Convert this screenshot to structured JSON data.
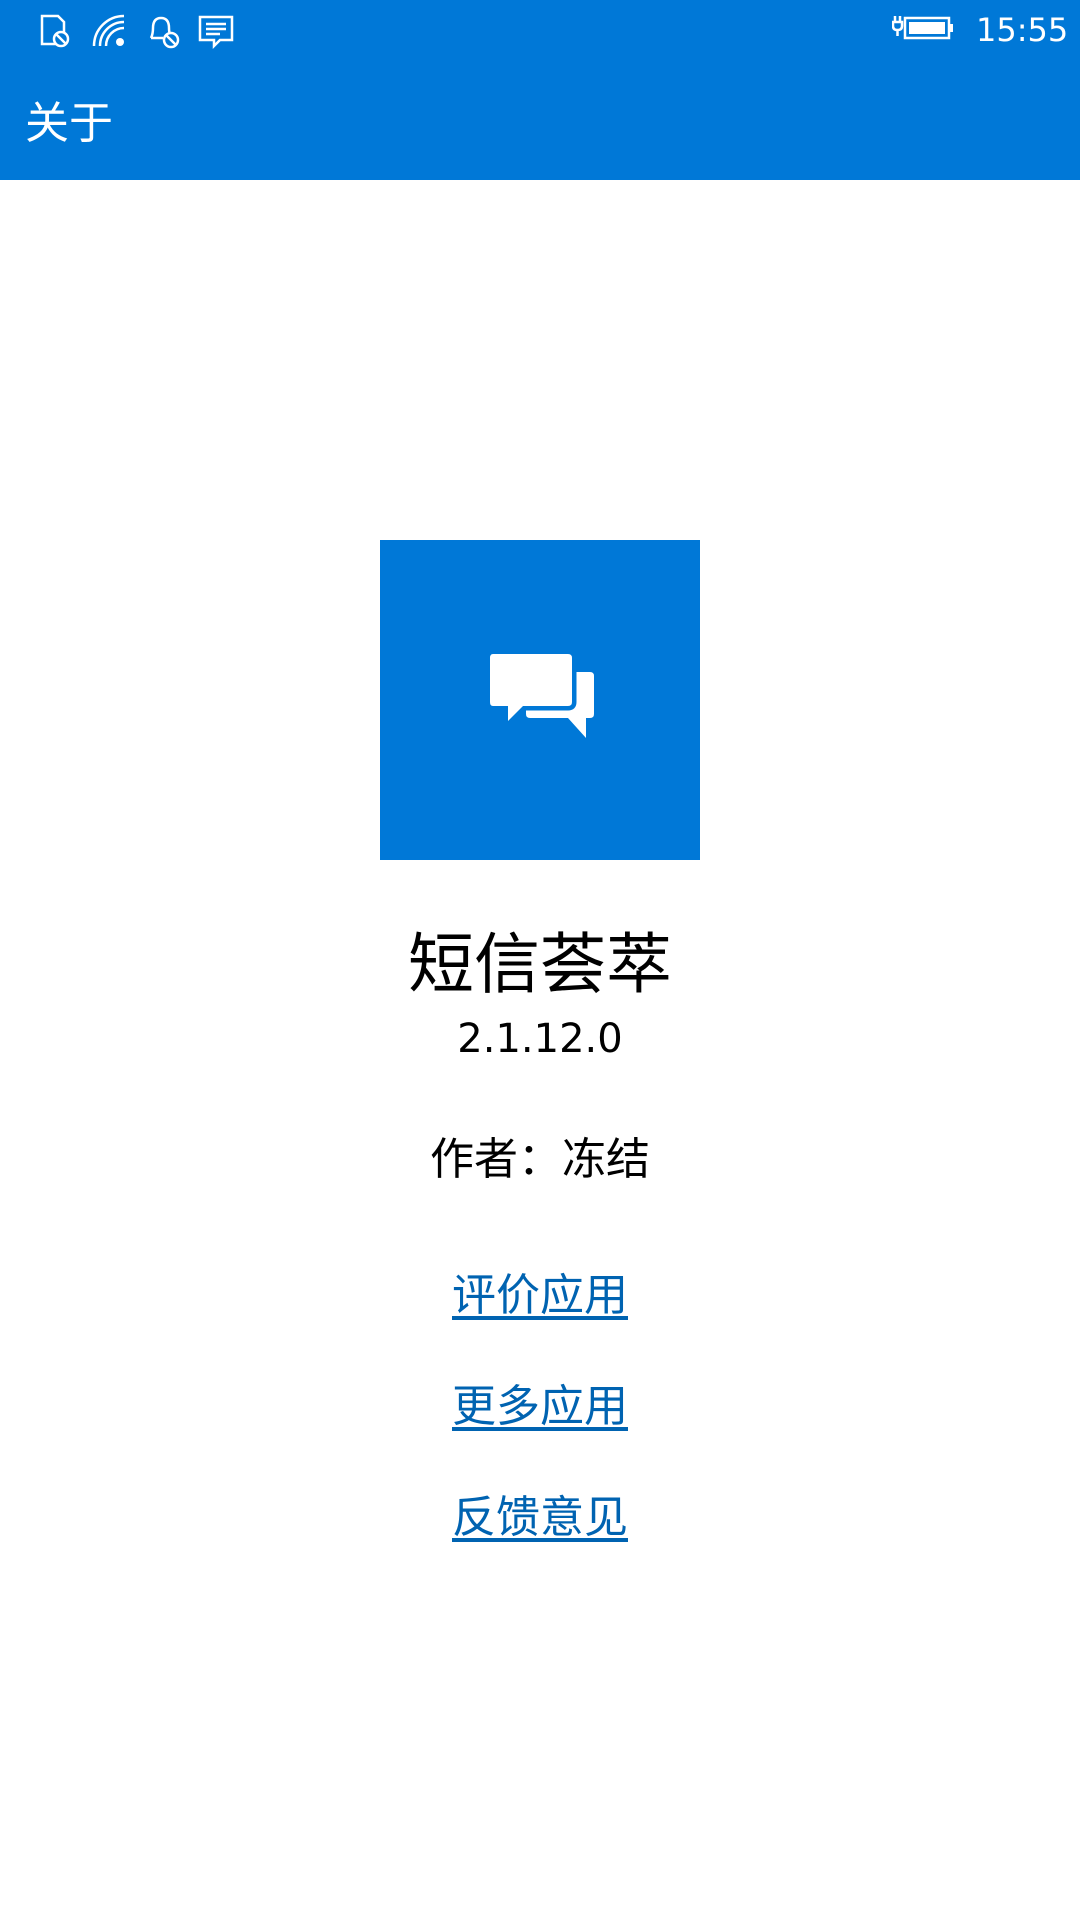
{
  "status_bar": {
    "icons": [
      "no-sim-icon",
      "wifi-icon",
      "quiet-hours-icon",
      "message-icon",
      "battery-charging-icon"
    ],
    "time": "15:55"
  },
  "header": {
    "title": "关于",
    "background_color": "#0078d7"
  },
  "app": {
    "logo_icon": "chat-bubbles-icon",
    "name": "短信荟萃",
    "version": "2.1.12.0",
    "author": "作者：冻结"
  },
  "links": {
    "rate": "评价应用",
    "more": "更多应用",
    "feedback": "反馈意见",
    "color": "#0063b1"
  }
}
